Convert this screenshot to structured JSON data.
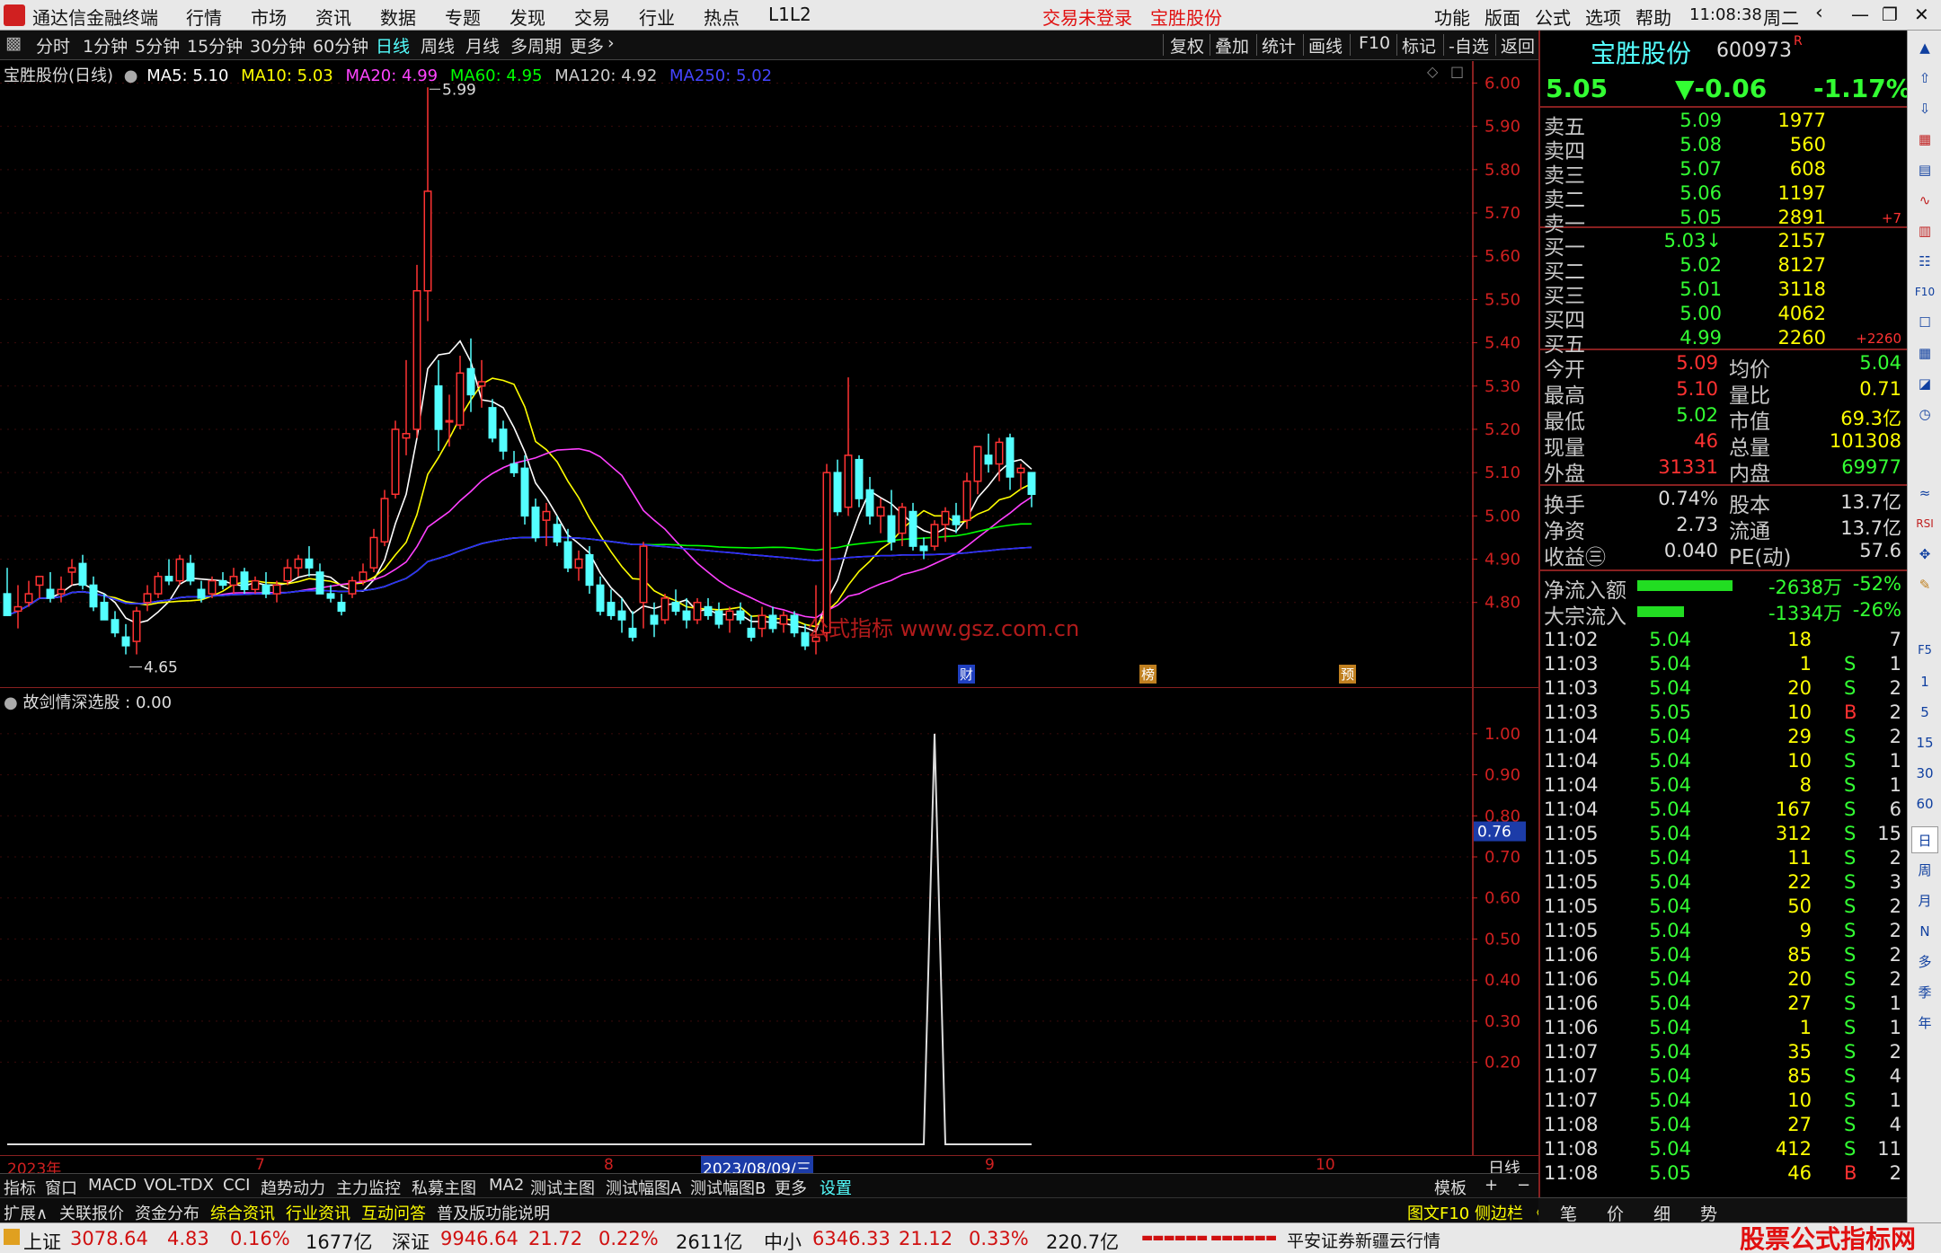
{
  "app": {
    "title": "通达信金融终端",
    "menus": [
      "行情",
      "市场",
      "资讯",
      "数据",
      "专题",
      "发现",
      "交易",
      "行业",
      "热点",
      "L1L2"
    ],
    "login_status": "交易未登录",
    "stock_name": "宝胜股份",
    "right_menus": [
      "功能",
      "版面",
      "公式",
      "选项",
      "帮助"
    ],
    "clock": "11:08:38",
    "weekday": "周二"
  },
  "toolbar": {
    "periods": [
      "分时",
      "1分钟",
      "5分钟",
      "15分钟",
      "30分钟",
      "60分钟",
      "日线",
      "周线",
      "月线",
      "多周期",
      "更多"
    ],
    "active_period": "日线",
    "right_buttons": [
      "复权",
      "叠加",
      "统计",
      "画线",
      "F10",
      "标记",
      "-自选",
      "返回"
    ]
  },
  "main_chart": {
    "header": {
      "title": "宝胜股份(日线)",
      "ma5": "MA5: 5.10",
      "ma10": "MA10: 5.03",
      "ma20": "MA20: 4.99",
      "ma60": "MA60: 4.95",
      "ma120": "MA120: 4.92",
      "ma250": "MA250: 5.02"
    },
    "colors": {
      "up": "#ff3232",
      "down": "#54ffff",
      "ma5": "#ffffff",
      "ma10": "#ffff00",
      "ma20": "#ff40ff",
      "ma60": "#00ff00",
      "ma120": "#c0c0c0",
      "ma250": "#2a2aff"
    },
    "high_label": "5.99",
    "low_label": "4.65",
    "markers": [
      "财",
      "榜",
      "预"
    ],
    "watermark": "公式指标 www.gsz.com.cn"
  },
  "chart_data": [
    {
      "type": "candlestick",
      "title": "宝胜股份(日线)",
      "y_ticks": [
        "6.00",
        "5.90",
        "5.80",
        "5.70",
        "5.60",
        "5.50",
        "5.40",
        "5.30",
        "5.20",
        "5.10",
        "5.00",
        "4.90",
        "4.80"
      ],
      "ylim": [
        4.65,
        6.03
      ],
      "x_labels": [
        "2023年",
        "7",
        "8",
        "2023/08/09/三",
        "9",
        "10"
      ],
      "ohlc": [
        [
          4.82,
          4.88,
          4.78,
          4.77
        ],
        [
          4.78,
          4.84,
          4.74,
          4.79
        ],
        [
          4.8,
          4.85,
          4.79,
          4.82
        ],
        [
          4.84,
          4.86,
          4.81,
          4.86
        ],
        [
          4.83,
          4.87,
          4.8,
          4.81
        ],
        [
          4.82,
          4.86,
          4.8,
          4.83
        ],
        [
          4.87,
          4.9,
          4.84,
          4.88
        ],
        [
          4.89,
          4.91,
          4.83,
          4.84
        ],
        [
          4.84,
          4.86,
          4.78,
          4.79
        ],
        [
          4.8,
          4.82,
          4.76,
          4.76
        ],
        [
          4.76,
          4.78,
          4.72,
          4.73
        ],
        [
          4.72,
          4.75,
          4.68,
          4.7
        ],
        [
          4.71,
          4.79,
          4.68,
          4.78
        ],
        [
          4.8,
          4.84,
          4.78,
          4.82
        ],
        [
          4.82,
          4.87,
          4.81,
          4.86
        ],
        [
          4.86,
          4.9,
          4.84,
          4.85
        ],
        [
          4.85,
          4.91,
          4.84,
          4.9
        ],
        [
          4.89,
          4.91,
          4.84,
          4.85
        ],
        [
          4.83,
          4.85,
          4.8,
          4.81
        ],
        [
          4.82,
          4.86,
          4.81,
          4.85
        ],
        [
          4.85,
          4.87,
          4.83,
          4.84
        ],
        [
          4.84,
          4.88,
          4.82,
          4.86
        ],
        [
          4.87,
          4.88,
          4.82,
          4.83
        ],
        [
          4.83,
          4.86,
          4.82,
          4.85
        ],
        [
          4.84,
          4.87,
          4.81,
          4.82
        ],
        [
          4.82,
          4.85,
          4.8,
          4.84
        ],
        [
          4.85,
          4.9,
          4.84,
          4.88
        ],
        [
          4.88,
          4.91,
          4.86,
          4.9
        ],
        [
          4.9,
          4.93,
          4.86,
          4.88
        ],
        [
          4.87,
          4.89,
          4.82,
          4.82
        ],
        [
          4.82,
          4.84,
          4.8,
          4.81
        ],
        [
          4.8,
          4.82,
          4.77,
          4.78
        ],
        [
          4.82,
          4.86,
          4.81,
          4.85
        ],
        [
          4.85,
          4.89,
          4.84,
          4.87
        ],
        [
          4.88,
          4.97,
          4.87,
          4.95
        ],
        [
          4.94,
          5.06,
          4.93,
          5.04
        ],
        [
          5.05,
          5.22,
          5.04,
          5.2
        ],
        [
          5.18,
          5.36,
          5.14,
          5.19
        ],
        [
          5.2,
          5.58,
          5.18,
          5.52
        ],
        [
          5.52,
          5.99,
          5.45,
          5.75
        ],
        [
          5.3,
          5.36,
          5.15,
          5.2
        ],
        [
          5.22,
          5.28,
          5.16,
          5.22
        ],
        [
          5.21,
          5.37,
          5.2,
          5.33
        ],
        [
          5.34,
          5.41,
          5.24,
          5.28
        ],
        [
          5.3,
          5.36,
          5.25,
          5.31
        ],
        [
          5.25,
          5.27,
          5.17,
          5.18
        ],
        [
          5.2,
          5.22,
          5.13,
          5.15
        ],
        [
          5.12,
          5.15,
          5.09,
          5.1
        ],
        [
          5.11,
          5.14,
          4.98,
          5.0
        ],
        [
          5.02,
          5.04,
          4.94,
          4.95
        ],
        [
          4.99,
          5.03,
          4.93,
          5.01
        ],
        [
          4.98,
          5.0,
          4.93,
          4.94
        ],
        [
          4.94,
          4.97,
          4.87,
          4.88
        ],
        [
          4.88,
          4.92,
          4.85,
          4.9
        ],
        [
          4.91,
          4.93,
          4.82,
          4.84
        ],
        [
          4.84,
          4.86,
          4.77,
          4.78
        ],
        [
          4.8,
          4.83,
          4.76,
          4.77
        ],
        [
          4.78,
          4.81,
          4.73,
          4.76
        ],
        [
          4.74,
          4.78,
          4.71,
          4.72
        ],
        [
          4.8,
          4.94,
          4.74,
          4.93
        ],
        [
          4.77,
          4.8,
          4.72,
          4.75
        ],
        [
          4.76,
          4.82,
          4.75,
          4.81
        ],
        [
          4.8,
          4.83,
          4.77,
          4.78
        ],
        [
          4.78,
          4.81,
          4.74,
          4.76
        ],
        [
          4.76,
          4.81,
          4.75,
          4.8
        ],
        [
          4.79,
          4.81,
          4.76,
          4.77
        ],
        [
          4.78,
          4.8,
          4.74,
          4.75
        ],
        [
          4.76,
          4.79,
          4.73,
          4.78
        ],
        [
          4.78,
          4.8,
          4.75,
          4.76
        ],
        [
          4.74,
          4.77,
          4.71,
          4.72
        ],
        [
          4.74,
          4.79,
          4.72,
          4.77
        ],
        [
          4.77,
          4.79,
          4.73,
          4.74
        ],
        [
          4.75,
          4.78,
          4.73,
          4.77
        ],
        [
          4.77,
          4.78,
          4.72,
          4.73
        ],
        [
          4.73,
          4.75,
          4.69,
          4.7
        ],
        [
          4.71,
          4.84,
          4.68,
          4.72
        ],
        [
          4.73,
          5.12,
          4.71,
          5.1
        ],
        [
          5.1,
          5.13,
          5.0,
          5.01
        ],
        [
          5.02,
          5.32,
          5.0,
          5.14
        ],
        [
          5.13,
          5.14,
          5.02,
          5.04
        ],
        [
          5.06,
          5.09,
          4.98,
          5.0
        ],
        [
          5.0,
          5.04,
          4.96,
          5.02
        ],
        [
          5.0,
          5.06,
          4.92,
          4.94
        ],
        [
          4.96,
          5.03,
          4.93,
          5.02
        ],
        [
          5.01,
          5.03,
          4.92,
          4.93
        ],
        [
          4.93,
          4.95,
          4.9,
          4.92
        ],
        [
          4.93,
          4.99,
          4.92,
          4.98
        ],
        [
          4.98,
          5.02,
          4.94,
          5.01
        ],
        [
          5.0,
          5.03,
          4.96,
          4.98
        ],
        [
          4.99,
          5.1,
          4.97,
          5.08
        ],
        [
          5.08,
          5.14,
          5.05,
          5.16
        ],
        [
          5.14,
          5.19,
          5.1,
          5.12
        ],
        [
          5.12,
          5.18,
          5.08,
          5.17
        ],
        [
          5.18,
          5.19,
          5.06,
          5.09
        ],
        [
          5.1,
          5.12,
          5.06,
          5.11
        ],
        [
          5.1,
          5.1,
          5.02,
          5.05
        ]
      ]
    },
    {
      "type": "line",
      "title": "故剑情深选股 : 0.00",
      "y_ticks": [
        "1.00",
        "0.90",
        "0.80",
        "0.70",
        "0.60",
        "0.50",
        "0.40",
        "0.30",
        "0.20"
      ],
      "ylim": [
        0,
        1.05
      ],
      "cursor_value": "0.76",
      "spike_at_index": 86,
      "spike_value": 1.0
    }
  ],
  "tabs": {
    "row1": [
      "指标",
      "窗口",
      "MACD",
      "VOL-TDX",
      "CCI",
      "趋势动力",
      "主力监控",
      "私募主图",
      "MA2",
      "测试主图",
      "测试幅图A",
      "测试幅图B",
      "更多",
      "设置"
    ],
    "row1_right": [
      "模板",
      "+",
      "−"
    ],
    "row2": [
      "扩展∧",
      "关联报价",
      "资金分布",
      "综合资讯",
      "行业资讯",
      "互动问答",
      "普及版功能说明"
    ],
    "row2_right": "图文F10 侧边栏 《",
    "period_label": "日线"
  },
  "quote": {
    "name": "宝胜股份",
    "code": "600973",
    "flag": "R",
    "price": "5.05",
    "change": "▼-0.06",
    "pct": "-1.17%",
    "asks": [
      [
        "卖五",
        "5.09",
        "1977",
        ""
      ],
      [
        "卖四",
        "5.08",
        "560",
        ""
      ],
      [
        "卖三",
        "5.07",
        "608",
        ""
      ],
      [
        "卖二",
        "5.06",
        "1197",
        ""
      ],
      [
        "卖一",
        "5.05",
        "2891",
        "+7"
      ]
    ],
    "bids": [
      [
        "买一",
        "5.03↓",
        "2157",
        ""
      ],
      [
        "买二",
        "5.02",
        "8127",
        ""
      ],
      [
        "买三",
        "5.01",
        "3118",
        ""
      ],
      [
        "买四",
        "5.00",
        "4062",
        ""
      ],
      [
        "买五",
        "4.99",
        "2260",
        "+2260"
      ]
    ],
    "stats": [
      [
        "今开",
        "5.09",
        "均价",
        "5.04"
      ],
      [
        "最高",
        "5.10",
        "量比",
        "0.71"
      ],
      [
        "最低",
        "5.02",
        "市值",
        "69.3亿"
      ],
      [
        "现量",
        "46",
        "总量",
        "101308"
      ],
      [
        "外盘",
        "31331",
        "内盘",
        "69977"
      ]
    ],
    "stats2": [
      [
        "换手",
        "0.74%",
        "股本",
        "13.7亿"
      ],
      [
        "净资",
        "2.73",
        "流通",
        "13.7亿"
      ],
      [
        "收益㊂",
        "0.040",
        "PE(动)",
        "57.6"
      ]
    ],
    "flows": [
      [
        "净流入额",
        "-2638万",
        "-52%"
      ],
      [
        "大宗流入",
        "-1334万",
        "-26%"
      ]
    ],
    "ticks": [
      [
        "11:02",
        "5.04",
        "18",
        "",
        "7"
      ],
      [
        "11:03",
        "5.04",
        "1",
        "S",
        "1"
      ],
      [
        "11:03",
        "5.04",
        "20",
        "S",
        "2"
      ],
      [
        "11:03",
        "5.05",
        "10",
        "B",
        "2"
      ],
      [
        "11:04",
        "5.04",
        "29",
        "S",
        "2"
      ],
      [
        "11:04",
        "5.04",
        "10",
        "S",
        "1"
      ],
      [
        "11:04",
        "5.04",
        "8",
        "S",
        "1"
      ],
      [
        "11:04",
        "5.04",
        "167",
        "S",
        "6"
      ],
      [
        "11:05",
        "5.04",
        "312",
        "S",
        "15"
      ],
      [
        "11:05",
        "5.04",
        "11",
        "S",
        "2"
      ],
      [
        "11:05",
        "5.04",
        "22",
        "S",
        "3"
      ],
      [
        "11:05",
        "5.04",
        "50",
        "S",
        "2"
      ],
      [
        "11:05",
        "5.04",
        "9",
        "S",
        "2"
      ],
      [
        "11:06",
        "5.04",
        "85",
        "S",
        "2"
      ],
      [
        "11:06",
        "5.04",
        "20",
        "S",
        "2"
      ],
      [
        "11:06",
        "5.04",
        "27",
        "S",
        "1"
      ],
      [
        "11:06",
        "5.04",
        "1",
        "S",
        "1"
      ],
      [
        "11:07",
        "5.04",
        "35",
        "S",
        "2"
      ],
      [
        "11:07",
        "5.04",
        "85",
        "S",
        "4"
      ],
      [
        "11:07",
        "5.04",
        "10",
        "S",
        "1"
      ],
      [
        "11:08",
        "5.04",
        "27",
        "S",
        "4"
      ],
      [
        "11:08",
        "5.04",
        "412",
        "S",
        "11"
      ],
      [
        "11:08",
        "5.05",
        "46",
        "B",
        "2"
      ]
    ],
    "bottom_tabs": [
      "笔",
      "价",
      "细",
      "势"
    ]
  },
  "sidebar": {
    "items": [
      "RSI",
      "F5",
      "1",
      "5",
      "15",
      "30",
      "60",
      "日",
      "周",
      "月",
      "N",
      "多",
      "季",
      "年"
    ]
  },
  "status": {
    "items": [
      [
        "上证",
        "3078.64",
        "4.83",
        "0.16%",
        "1677亿"
      ],
      [
        "深证",
        "9946.64",
        "21.72",
        "0.22%",
        "2611亿"
      ],
      [
        "中小",
        "6346.33",
        "21.12",
        "0.33%",
        "220.7亿"
      ]
    ],
    "broker": "平安证券新疆云行情",
    "logo": "股票公式指标网",
    "logo_url": "www.gsgzx.com"
  }
}
